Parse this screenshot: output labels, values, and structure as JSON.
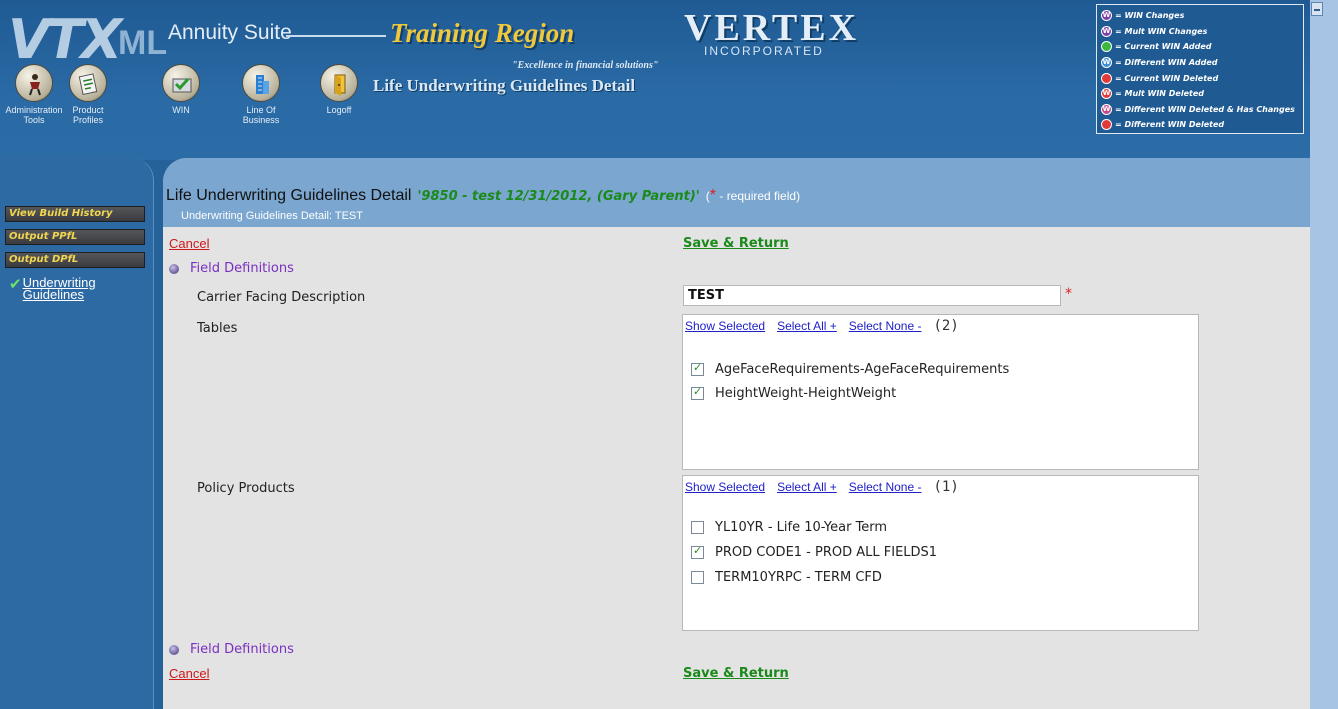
{
  "header": {
    "logo_vtx": "VTX",
    "logo_ml": "ML",
    "suite": "Annuity Suite",
    "region": "Training Region",
    "vertex": "VERTEX",
    "incorporated": "INCORPORATED",
    "slogan": "\"Excellence in financial solutions\"",
    "page_title": "Life Underwriting Guidelines Detail",
    "nav": [
      {
        "label1": "Administration",
        "label2": "Tools",
        "icon": "person-icon"
      },
      {
        "label1": "Product",
        "label2": "Profiles",
        "icon": "document-icon"
      },
      {
        "label1": "WIN",
        "label2": "",
        "icon": "inbox-check-icon"
      },
      {
        "label1": "Line Of",
        "label2": "Business",
        "icon": "building-icon"
      },
      {
        "label1": "Logoff",
        "label2": "",
        "icon": "door-icon"
      }
    ]
  },
  "legend": [
    {
      "symbol": "W",
      "color": "#7b3fa8",
      "text": "= WIN Changes"
    },
    {
      "symbol": "W",
      "color": "#7b3fa8",
      "text": "= Mult WIN Changes"
    },
    {
      "symbol": "",
      "color": "#3db83d",
      "text": "= Current WIN Added"
    },
    {
      "symbol": "W",
      "color": "#3f8fd6",
      "text": "= Different WIN Added"
    },
    {
      "symbol": "",
      "color": "#e03a3a",
      "text": "= Current WIN Deleted"
    },
    {
      "symbol": "W",
      "color": "#e03a3a",
      "text": "= Mult WIN Deleted"
    },
    {
      "symbol": "W",
      "color": "#c04a8a",
      "text": "= Different WIN Deleted & Has Changes"
    },
    {
      "symbol": "",
      "color": "#e03a3a",
      "text": "= Different WIN Deleted"
    }
  ],
  "sidebar": {
    "buttons": [
      "View Build History",
      "Output PPfL",
      "Output DPfL"
    ],
    "link": "Underwriting Guidelines"
  },
  "main": {
    "title": "Life Underwriting Guidelines Detail",
    "context": "'9850 - test 12/31/2012, (Gary Parent)'",
    "required_star": "*",
    "required_note": "- required field)",
    "required_open": "(",
    "subtitle": "Underwriting Guidelines Detail: TEST",
    "cancel": "Cancel",
    "save": "Save & Return",
    "field_definitions": "Field Definitions",
    "carrier_label": "Carrier Facing Description",
    "carrier_value": "TEST",
    "tables_label": "Tables",
    "products_label": "Policy Products",
    "show_selected": "Show Selected",
    "select_all": "Select All +",
    "select_none": "Select None -",
    "tables_count": "(2)",
    "products_count": "(1)",
    "tables": [
      {
        "label": "AgeFaceRequirements-AgeFaceRequirements",
        "checked": true
      },
      {
        "label": "HeightWeight-HeightWeight",
        "checked": true
      }
    ],
    "products": [
      {
        "label": "YL10YR - Life 10-Year Term",
        "checked": false
      },
      {
        "label": "PROD CODE1 - PROD ALL FIELDS1",
        "checked": true
      },
      {
        "label": "TERM10YRPC - TERM CFD",
        "checked": false
      }
    ]
  }
}
